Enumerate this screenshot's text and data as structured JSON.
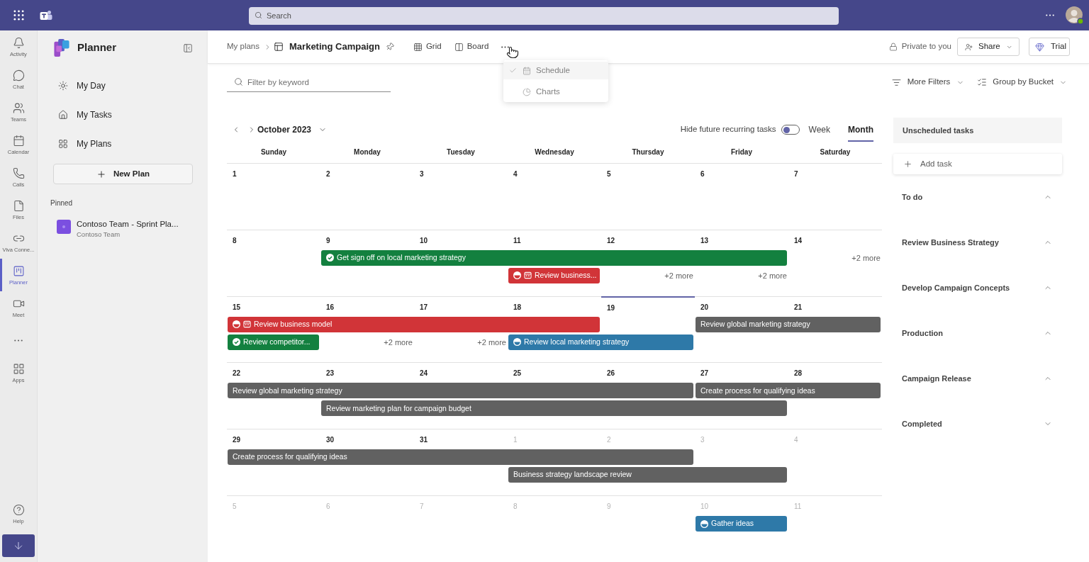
{
  "top_bar": {
    "search": {
      "placeholder": "Search"
    }
  },
  "rail": {
    "items": [
      {
        "kind": "app",
        "label": "Activity",
        "selected": false
      },
      {
        "kind": "app",
        "label": "Chat",
        "selected": false
      },
      {
        "kind": "app",
        "label": "Teams",
        "selected": false
      },
      {
        "kind": "app",
        "label": "Calendar",
        "selected": false
      },
      {
        "kind": "app",
        "label": "Calls",
        "selected": false
      },
      {
        "kind": "app",
        "label": "Files",
        "selected": false
      },
      {
        "kind": "app",
        "label": "Viva Conne...",
        "selected": false
      },
      {
        "kind": "app",
        "label": "Planner",
        "selected": true
      },
      {
        "kind": "app",
        "label": "Meet",
        "selected": false
      },
      {
        "kind": "more"
      },
      {
        "kind": "app",
        "label": "Apps",
        "selected": false
      }
    ],
    "help": {
      "label": "Help"
    }
  },
  "sidebar": {
    "title": "Planner",
    "nav": [
      {
        "label": "My Day"
      },
      {
        "label": "My Tasks"
      },
      {
        "label": "My Plans"
      }
    ],
    "new_plan": "New Plan",
    "pinned_heading": "Pinned",
    "pinned": [
      {
        "title": "Contoso Team - Sprint Pla...",
        "subtitle": "Contoso Team"
      }
    ]
  },
  "header": {
    "breadcrumb": "My plans",
    "plan_title": "Marketing Campaign",
    "views": [
      {
        "label": "Grid"
      },
      {
        "label": "Board"
      }
    ],
    "privacy": "Private to you",
    "share": "Share",
    "trial": "Trial"
  },
  "view_menu": {
    "items": [
      {
        "label": "Schedule",
        "checked": true
      },
      {
        "label": "Charts",
        "checked": false
      }
    ]
  },
  "filter": {
    "placeholder": "Filter by keyword",
    "more_filters": "More Filters",
    "group_by": "Group by Bucket"
  },
  "calendar": {
    "month": "October 2023",
    "recurring_toggle": {
      "label": "Hide future recurring tasks",
      "on": false
    },
    "modes": [
      {
        "label": "Week",
        "selected": false
      },
      {
        "label": "Month",
        "selected": true
      }
    ],
    "weekdays": [
      "Sunday",
      "Monday",
      "Tuesday",
      "Wednesday",
      "Thursday",
      "Friday",
      "Saturday"
    ],
    "weeks": [
      {
        "days": [
          {
            "date": "1",
            "muted": false,
            "today": false
          },
          {
            "date": "2",
            "muted": false,
            "today": false
          },
          {
            "date": "3",
            "muted": false,
            "today": false
          },
          {
            "date": "4",
            "muted": false,
            "today": false
          },
          {
            "date": "5",
            "muted": false,
            "today": false
          },
          {
            "date": "6",
            "muted": false,
            "today": false
          },
          {
            "date": "7",
            "muted": false,
            "today": false
          }
        ]
      },
      {
        "days": [
          {
            "date": "8",
            "muted": false,
            "today": false
          },
          {
            "date": "9",
            "muted": false,
            "today": false
          },
          {
            "date": "10",
            "muted": false,
            "today": false
          },
          {
            "date": "11",
            "muted": false,
            "today": false
          },
          {
            "date": "12",
            "muted": false,
            "today": false
          },
          {
            "date": "13",
            "muted": false,
            "today": false
          },
          {
            "date": "14",
            "muted": false,
            "today": false
          }
        ],
        "lanes": [
          [
            {
              "kind": "empty"
            },
            {
              "kind": "task",
              "title": "Get sign off on local marketing strategy",
              "color": "#13803f",
              "completed": true
            },
            {
              "kind": "continued"
            },
            {
              "kind": "continued"
            },
            {
              "kind": "continued"
            },
            {
              "kind": "continued"
            },
            {
              "kind": "more",
              "label": "+2 more"
            }
          ],
          [
            {
              "kind": "empty"
            },
            {
              "kind": "empty"
            },
            {
              "kind": "empty"
            },
            {
              "kind": "task",
              "title": "Review business...",
              "color": "#d13438",
              "in_progress": true,
              "details_icon": true
            },
            {
              "kind": "more",
              "label": "+2 more"
            },
            {
              "kind": "more",
              "label": "+2 more"
            },
            {
              "kind": "empty"
            }
          ]
        ]
      },
      {
        "days": [
          {
            "date": "15",
            "muted": false,
            "today": false
          },
          {
            "date": "16",
            "muted": false,
            "today": false
          },
          {
            "date": "17",
            "muted": false,
            "today": false
          },
          {
            "date": "18",
            "muted": false,
            "today": false
          },
          {
            "date": "19",
            "muted": false,
            "today": true
          },
          {
            "date": "20",
            "muted": false,
            "today": false
          },
          {
            "date": "21",
            "muted": false,
            "today": false
          }
        ],
        "lanes": [
          [
            {
              "kind": "task",
              "title": "Review business model",
              "color": "#d13438",
              "in_progress": true,
              "details_icon": true
            },
            {
              "kind": "continued"
            },
            {
              "kind": "continued"
            },
            {
              "kind": "continued"
            },
            {
              "kind": "empty"
            },
            {
              "kind": "task",
              "title": "Review global marketing strategy",
              "color": "#616161"
            },
            {
              "kind": "continued"
            }
          ],
          [
            {
              "kind": "task",
              "title": "Review competitor...",
              "color": "#13803f",
              "completed": true
            },
            {
              "kind": "more",
              "label": "+2 more"
            },
            {
              "kind": "more",
              "label": "+2 more"
            },
            {
              "kind": "task",
              "title": "Review local marketing strategy",
              "color": "#2e79a8",
              "in_progress": true
            },
            {
              "kind": "continued"
            },
            {
              "kind": "empty"
            },
            {
              "kind": "empty"
            }
          ]
        ]
      },
      {
        "days": [
          {
            "date": "22",
            "muted": false,
            "today": false
          },
          {
            "date": "23",
            "muted": false,
            "today": false
          },
          {
            "date": "24",
            "muted": false,
            "today": false
          },
          {
            "date": "25",
            "muted": false,
            "today": false
          },
          {
            "date": "26",
            "muted": false,
            "today": false
          },
          {
            "date": "27",
            "muted": false,
            "today": false
          },
          {
            "date": "28",
            "muted": false,
            "today": false
          }
        ],
        "lanes": [
          [
            {
              "kind": "task",
              "title": "Review global marketing strategy",
              "color": "#616161"
            },
            {
              "kind": "continued"
            },
            {
              "kind": "continued"
            },
            {
              "kind": "continued"
            },
            {
              "kind": "continued"
            },
            {
              "kind": "task",
              "title": "Create process for qualifying ideas",
              "color": "#616161"
            },
            {
              "kind": "continued"
            }
          ],
          [
            {
              "kind": "empty"
            },
            {
              "kind": "task",
              "title": "Review marketing plan for campaign budget",
              "color": "#616161"
            },
            {
              "kind": "continued"
            },
            {
              "kind": "continued"
            },
            {
              "kind": "continued"
            },
            {
              "kind": "continued"
            },
            {
              "kind": "empty"
            }
          ]
        ]
      },
      {
        "days": [
          {
            "date": "29",
            "muted": false,
            "today": false
          },
          {
            "date": "30",
            "muted": false,
            "today": false
          },
          {
            "date": "31",
            "muted": false,
            "today": false
          },
          {
            "date": "1",
            "muted": true,
            "today": false
          },
          {
            "date": "2",
            "muted": true,
            "today": false
          },
          {
            "date": "3",
            "muted": true,
            "today": false
          },
          {
            "date": "4",
            "muted": true,
            "today": false
          }
        ],
        "lanes": [
          [
            {
              "kind": "task",
              "title": "Create process for qualifying ideas",
              "color": "#616161"
            },
            {
              "kind": "continued"
            },
            {
              "kind": "continued"
            },
            {
              "kind": "continued"
            },
            {
              "kind": "continued"
            },
            {
              "kind": "empty"
            },
            {
              "kind": "empty"
            }
          ],
          [
            {
              "kind": "empty"
            },
            {
              "kind": "empty"
            },
            {
              "kind": "empty"
            },
            {
              "kind": "task",
              "title": "Business strategy landscape review",
              "color": "#616161"
            },
            {
              "kind": "continued"
            },
            {
              "kind": "continued"
            },
            {
              "kind": "empty"
            }
          ]
        ]
      },
      {
        "days": [
          {
            "date": "5",
            "muted": true,
            "today": false
          },
          {
            "date": "6",
            "muted": true,
            "today": false
          },
          {
            "date": "7",
            "muted": true,
            "today": false
          },
          {
            "date": "8",
            "muted": true,
            "today": false
          },
          {
            "date": "9",
            "muted": true,
            "today": false
          },
          {
            "date": "10",
            "muted": true,
            "today": false
          },
          {
            "date": "11",
            "muted": true,
            "today": false
          }
        ],
        "lanes": [
          [
            {
              "kind": "empty"
            },
            {
              "kind": "empty"
            },
            {
              "kind": "empty"
            },
            {
              "kind": "empty"
            },
            {
              "kind": "empty"
            },
            {
              "kind": "task",
              "title": "Gather ideas",
              "color": "#2e79a8",
              "in_progress": true
            },
            {
              "kind": "empty"
            }
          ]
        ]
      }
    ]
  },
  "unscheduled": {
    "title": "Unscheduled tasks",
    "add_task": "Add task",
    "buckets": [
      {
        "label": "To do",
        "expanded": true
      },
      {
        "label": "Review Business Strategy",
        "expanded": true
      },
      {
        "label": "Develop Campaign Concepts",
        "expanded": true
      },
      {
        "label": "Production",
        "expanded": true
      },
      {
        "label": "Campaign Release",
        "expanded": true
      },
      {
        "label": "Completed",
        "expanded": false
      }
    ]
  }
}
